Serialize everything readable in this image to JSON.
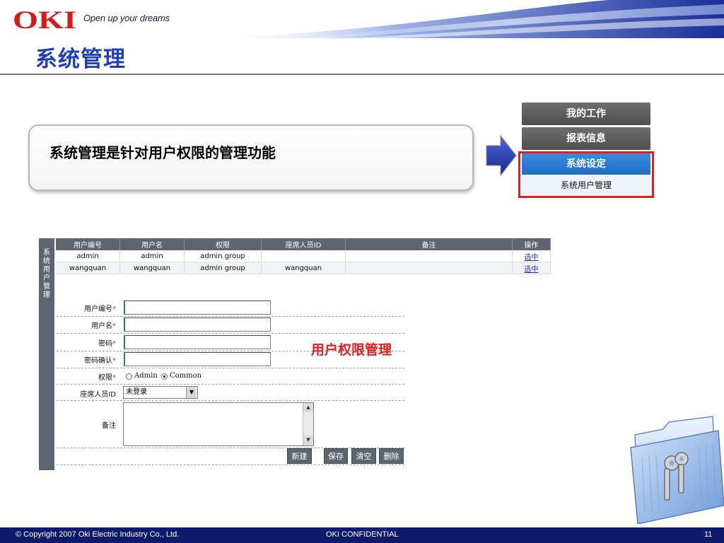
{
  "header": {
    "logo_text": "OKI",
    "tagline": "Open up your dreams",
    "page_title": "系统管理"
  },
  "callout": {
    "text": "系统管理是针对用户权限的管理功能"
  },
  "menu": {
    "items": [
      "我的工作",
      "报表信息",
      "系统设定"
    ],
    "sub_item": "系统用户管理"
  },
  "side_label": "系\n统\n用\n户\n管\n理",
  "table": {
    "headers": [
      "用户编号",
      "用户名",
      "权限",
      "座席人员ID",
      "备注",
      "操作"
    ],
    "rows": [
      [
        "admin",
        "admin",
        "admin group",
        "",
        "",
        "选中"
      ],
      [
        "wangquan",
        "wangquan",
        "admin group",
        "wangquan",
        "",
        "选中"
      ]
    ]
  },
  "form": {
    "labels": {
      "user_id": "用户编号",
      "user_name": "用户名",
      "password": "密码",
      "password_confirm": "密码确认",
      "permission": "权限",
      "seat_id": "座席人员ID",
      "remark": "备注"
    },
    "required_mark": "*",
    "permission_options": [
      "Admin",
      "Common"
    ],
    "permission_selected": "Common",
    "seat_select_value": "未登录",
    "buttons": {
      "new": "新建",
      "save": "保存",
      "clear": "清空",
      "delete": "删除"
    }
  },
  "annotation": "用户权限管理",
  "footer": {
    "copyright": "© Copyright 2007 Oki Electric Industry Co., Ltd.",
    "confidential": "OKI CONFIDENTIAL",
    "page_number": "11"
  },
  "colors": {
    "title_blue": "#1f3fb8",
    "footer_navy": "#0e1a6c",
    "logo_red": "#d41a1a",
    "highlight_red": "#e02020",
    "menu_blue": "#1e6ec6",
    "panel_gray": "#5d6670"
  }
}
